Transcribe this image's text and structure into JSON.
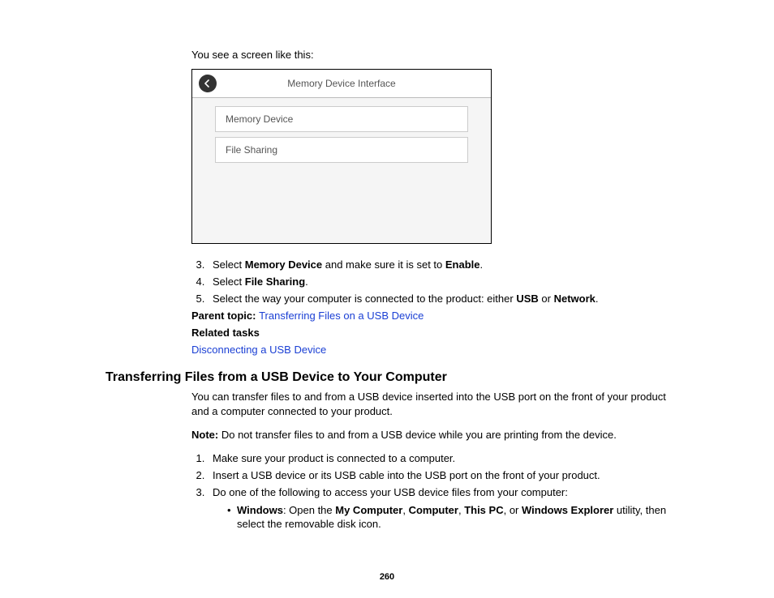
{
  "intro": "You see a screen like this:",
  "screenshot": {
    "title": "Memory Device Interface",
    "row1": "Memory Device",
    "row2": "File Sharing"
  },
  "steps_a": {
    "s3_pre": "Select ",
    "s3_b1": "Memory Device",
    "s3_mid": " and make sure it is set to ",
    "s3_b2": "Enable",
    "s3_post": ".",
    "s4_pre": "Select ",
    "s4_b1": "File Sharing",
    "s4_post": ".",
    "s5_pre": "Select the way your computer is connected to the product: either ",
    "s5_b1": "USB",
    "s5_mid": " or ",
    "s5_b2": "Network",
    "s5_post": "."
  },
  "parent_label": "Parent topic: ",
  "parent_link": "Transferring Files on a USB Device",
  "related_label": "Related tasks",
  "related_link": "Disconnecting a USB Device",
  "section_title": "Transferring Files from a USB Device to Your Computer",
  "para1": "You can transfer files to and from a USB device inserted into the USB port on the front of your product and a computer connected to your product.",
  "note_label": "Note: ",
  "note_text": "Do not transfer files to and from a USB device while you are printing from the device.",
  "steps_b": {
    "s1": "Make sure your product is connected to a computer.",
    "s2": "Insert a USB device or its USB cable into the USB port on the front of your product.",
    "s3": "Do one of the following to access your USB device files from your computer:"
  },
  "bullet": {
    "b1": "Windows",
    "t1": ": Open the ",
    "b2": "My Computer",
    "t2": ", ",
    "b3": "Computer",
    "t3": ", ",
    "b4": "This PC",
    "t4": ", or ",
    "b5": "Windows Explorer",
    "t5": " utility, then select the removable disk icon."
  },
  "page_number": "260"
}
